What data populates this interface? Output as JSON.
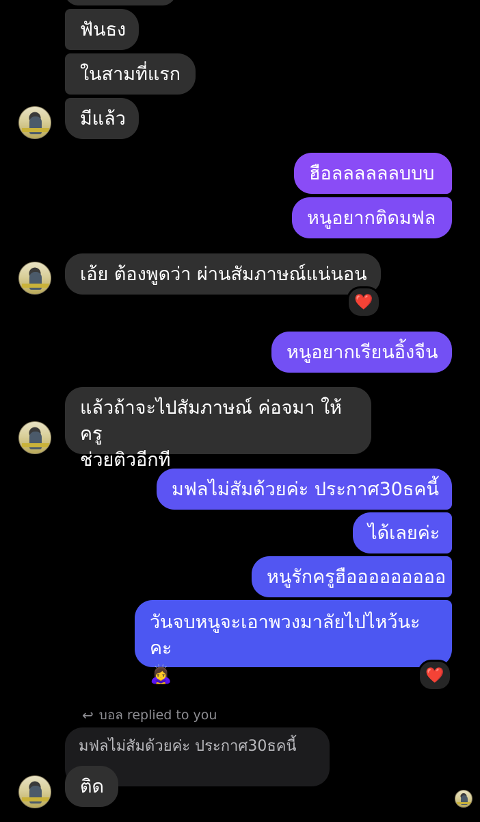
{
  "colors": {
    "background": "#000000",
    "incoming_bubble": "#303030",
    "outgoing_top": "#8a4cf6",
    "outgoing_bottom": "#4a56f2",
    "reaction_heart": "#ff2d46"
  },
  "messages": {
    "m1": "ฟันธง",
    "m2": "ในสามที่แรก",
    "m3": "มีแล้ว",
    "m4": "ฮือลลลลลลบบบ",
    "m5": "หนูอยากติดมฟล",
    "m6": "เอ้ย ต้องพูดว่า ผ่านสัมภาษณ์แน่นอน",
    "m7": "หนูอยากเรียนอิ้งจีน",
    "m8_line1": "แล้วถ้าจะไปสัมภาษณ์ ค่อจมา ให้ครู",
    "m8_line2": "ช่วยติวอีกที",
    "m9": "มฟลไม่สัมด้วยค่ะ ประกาศ30ธคนี้",
    "m10": "ได้เลยค่ะ",
    "m11": "หนูรักครูฮือออออออออ",
    "m12_line1": "วันจบหนูจะเอาพวงมาลัยไปไหว้นะคะ",
    "m12_emoji": "🙇‍♀️",
    "m13": "ติด"
  },
  "reactions": {
    "heart": "❤️"
  },
  "reply": {
    "meta": "บอล replied to you",
    "icon": "reply-arrow-icon",
    "arrow_glyph": "↩",
    "quoted_text": "มฟลไม่สัมด้วยค่ะ ประกาศ30ธคนี้"
  }
}
